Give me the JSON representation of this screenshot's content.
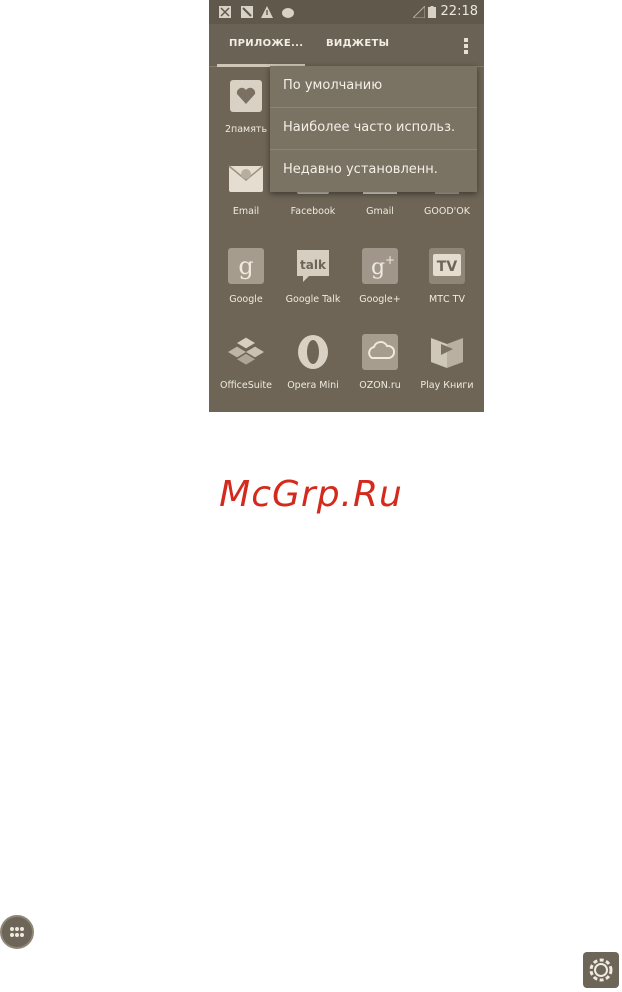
{
  "statusbar": {
    "time": "22:18",
    "icons": [
      "notification-icon",
      "notification-icon",
      "warning-icon",
      "android-icon",
      "signal-icon",
      "battery-icon"
    ]
  },
  "tabs": [
    {
      "label": "ПРИЛОЖЕ..."
    },
    {
      "label": "ВИДЖЕТЫ"
    }
  ],
  "menu": {
    "items": [
      {
        "label": "По умолчанию"
      },
      {
        "label": "Наиболее часто использ."
      },
      {
        "label": "Недавно установленн."
      }
    ]
  },
  "apps": [
    {
      "label": "2память",
      "icon": "heart-icon"
    },
    {
      "label": "Email",
      "icon": "email-icon"
    },
    {
      "label": "Facebook",
      "icon": "facebook-icon"
    },
    {
      "label": "Gmail",
      "icon": "gmail-icon"
    },
    {
      "label": "GOOD'OK",
      "icon": "goodok-icon"
    },
    {
      "label": "Google",
      "icon": "google-icon"
    },
    {
      "label": "Google Talk",
      "icon": "talk-icon"
    },
    {
      "label": "Google+",
      "icon": "googleplus-icon"
    },
    {
      "label": "МТС TV",
      "icon": "tv-icon"
    },
    {
      "label": "OfficeSuite",
      "icon": "officesuite-icon"
    },
    {
      "label": "Opera Mini",
      "icon": "opera-icon"
    },
    {
      "label": "OZON.ru",
      "icon": "ozon-icon"
    },
    {
      "label": "Play Книги",
      "icon": "books-icon"
    }
  ],
  "watermark": "McGrp.Ru",
  "colors": {
    "screen_bg": "#6e6556",
    "accent": "#cfc7b8",
    "watermark": "#d42a1e"
  }
}
